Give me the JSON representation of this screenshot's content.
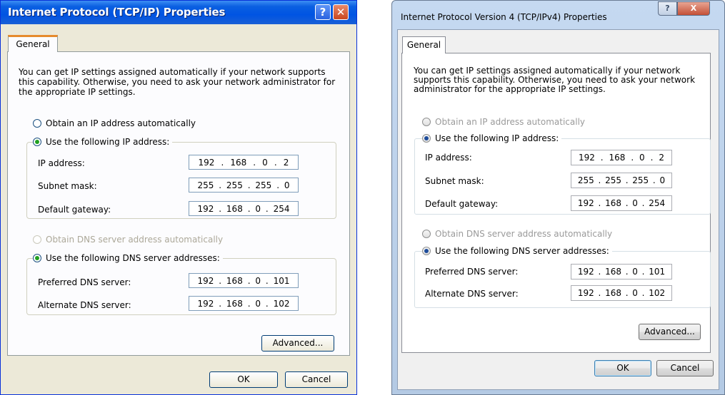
{
  "xp": {
    "title": "Internet Protocol (TCP/IP) Properties",
    "help_glyph": "?",
    "close_glyph": "✕",
    "tab": "General",
    "intro": "You can get IP settings assigned automatically if your network supports this capability. Otherwise, you need to ask your network administrator for the appropriate IP settings.",
    "radio_auto_ip": "Obtain an IP address automatically",
    "radio_static_ip": "Use the following IP address:",
    "ip_label": "IP address:",
    "ip": [
      "192",
      "168",
      "0",
      "2"
    ],
    "mask_label": "Subnet mask:",
    "mask": [
      "255",
      "255",
      "255",
      "0"
    ],
    "gw_label": "Default gateway:",
    "gw": [
      "192",
      "168",
      "0",
      "254"
    ],
    "radio_auto_dns": "Obtain DNS server address automatically",
    "radio_static_dns": "Use the following DNS server addresses:",
    "pdns_label": "Preferred DNS server:",
    "pdns": [
      "192",
      "168",
      "0",
      "101"
    ],
    "adns_label": "Alternate DNS server:",
    "adns": [
      "192",
      "168",
      "0",
      "102"
    ],
    "advanced": "Advanced...",
    "ok": "OK",
    "cancel": "Cancel",
    "dot": "."
  },
  "w7": {
    "title": "Internet Protocol Version 4 (TCP/IPv4) Properties",
    "help_glyph": "?",
    "close_glyph": "X",
    "tab": "General",
    "intro": "You can get IP settings assigned automatically if your network supports this capability. Otherwise, you need to ask your network administrator for the appropriate IP settings.",
    "radio_auto_ip": "Obtain an IP address automatically",
    "radio_static_ip": "Use the following IP address:",
    "ip_label": "IP address:",
    "ip": [
      "192",
      "168",
      "0",
      "2"
    ],
    "mask_label": "Subnet mask:",
    "mask": [
      "255",
      "255",
      "255",
      "0"
    ],
    "gw_label": "Default gateway:",
    "gw": [
      "192",
      "168",
      "0",
      "254"
    ],
    "radio_auto_dns": "Obtain DNS server address automatically",
    "radio_static_dns": "Use the following DNS server addresses:",
    "pdns_label": "Preferred DNS server:",
    "pdns": [
      "192",
      "168",
      "0",
      "101"
    ],
    "adns_label": "Alternate DNS server:",
    "adns": [
      "192",
      "168",
      "0",
      "102"
    ],
    "advanced": "Advanced...",
    "ok": "OK",
    "cancel": "Cancel",
    "dot": "."
  }
}
